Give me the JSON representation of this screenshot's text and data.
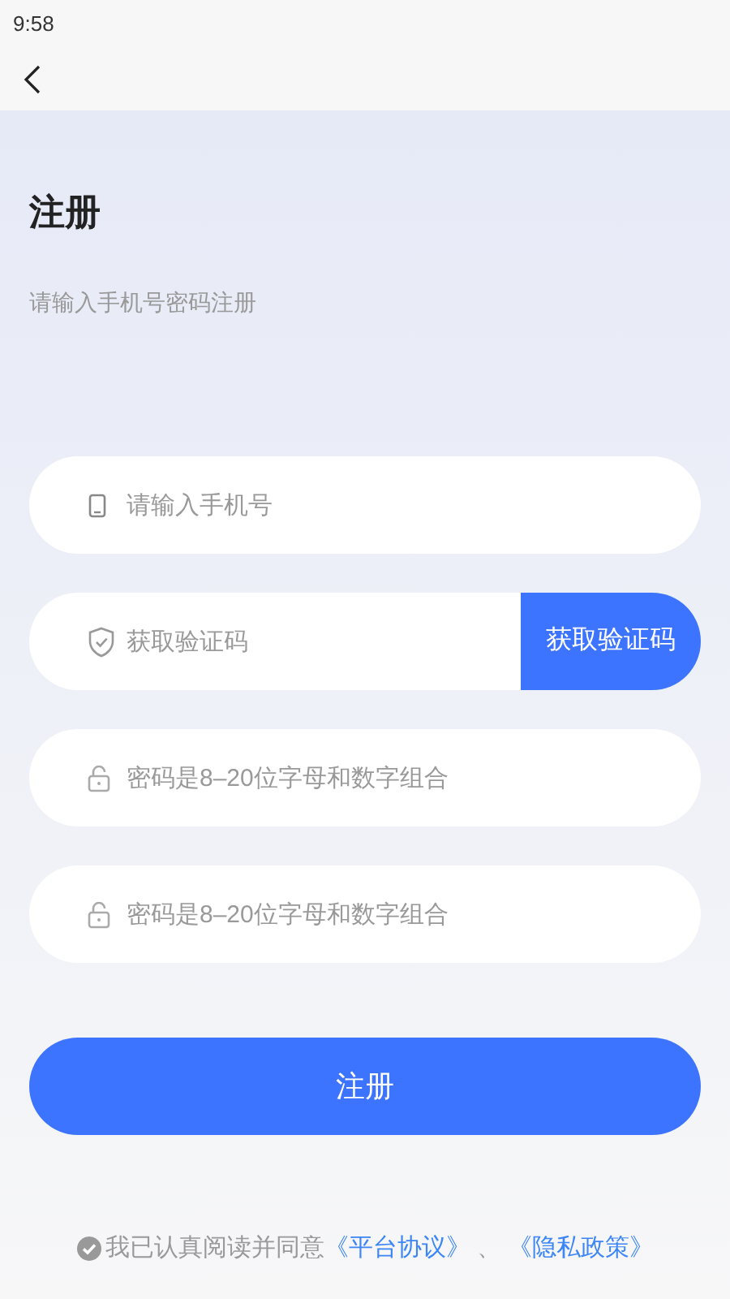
{
  "status_bar": {
    "time": "9:58"
  },
  "title": "注册",
  "subtitle": "请输入手机号密码注册",
  "fields": [
    {
      "kind": "phone",
      "placeholder": "请输入手机号"
    },
    {
      "kind": "code",
      "placeholder": "获取验证码",
      "button": "获取验证码"
    },
    {
      "kind": "password",
      "placeholder": "密码是8–20位字母和数字组合"
    },
    {
      "kind": "password",
      "placeholder": "密码是8–20位字母和数字组合"
    }
  ],
  "submit": "注册",
  "agreement": {
    "checked": false,
    "text": "我已认真阅读并同意",
    "links": [
      "《平台协议》",
      "《隐私政策》"
    ],
    "separator": "、"
  }
}
